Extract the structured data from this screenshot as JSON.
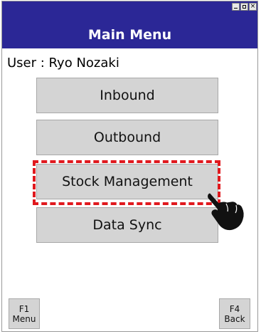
{
  "window": {
    "title": "Main Menu",
    "minimize_glyph": "",
    "maximize_glyph": "",
    "close_glyph": "×"
  },
  "user_line": "User : Ryo Nozaki",
  "menu": {
    "items": [
      {
        "label": "Inbound"
      },
      {
        "label": "Outbound"
      },
      {
        "label": "Stock Management"
      },
      {
        "label": "Data Sync"
      }
    ],
    "highlighted_item": "Stock Management"
  },
  "function_keys": {
    "f1": {
      "key": "F1",
      "label": "Menu"
    },
    "f4": {
      "key": "F4",
      "label": "Back"
    }
  },
  "colors": {
    "titlebar": "#2b2796",
    "button_face": "#d4d4d4",
    "highlight": "#e0191e"
  },
  "icons": {
    "pointer": "tap-hand-icon"
  }
}
